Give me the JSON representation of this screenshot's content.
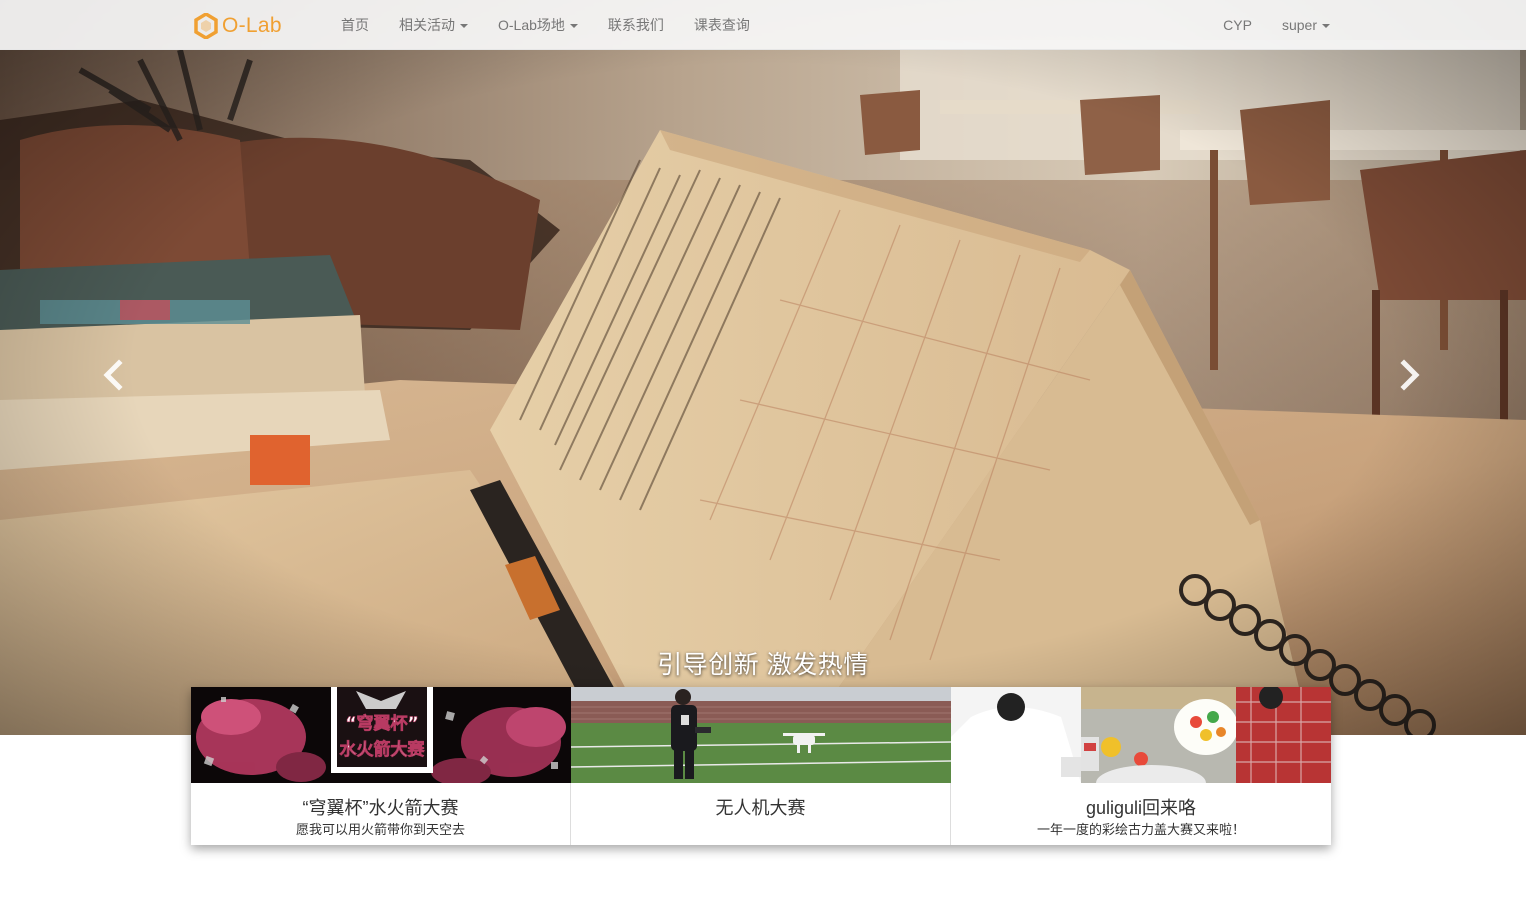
{
  "colors": {
    "brand": "#f0a032",
    "nav_text": "#777777",
    "navbar_bg": "#f8f8f8"
  },
  "navbar": {
    "brand": {
      "text": "O-Lab",
      "icon": "hexagon-logo-icon"
    },
    "left_items": [
      {
        "label": "首页",
        "dropdown": false
      },
      {
        "label": "相关活动",
        "dropdown": true
      },
      {
        "label": "O-Lab场地",
        "dropdown": true
      },
      {
        "label": "联系我们",
        "dropdown": false
      },
      {
        "label": "课表查询",
        "dropdown": false
      }
    ],
    "right_items": [
      {
        "label": "CYP",
        "dropdown": false
      },
      {
        "label": "super",
        "dropdown": true
      }
    ]
  },
  "carousel": {
    "caption": "引导创新 激发热情",
    "prev_icon": "chevron-left-icon",
    "next_icon": "chevron-right-icon"
  },
  "cards": [
    {
      "title": "“穹翼杯”水火箭大赛",
      "subtitle": "愿我可以用火箭带你到天空去",
      "poster_text": [
        "“穹翼杯”",
        "水火箭大赛"
      ]
    },
    {
      "title": "无人机大赛",
      "subtitle": ""
    },
    {
      "title": "guliguli回来咯",
      "subtitle": "一年一度的彩绘古力盖大赛又来啦！"
    }
  ]
}
